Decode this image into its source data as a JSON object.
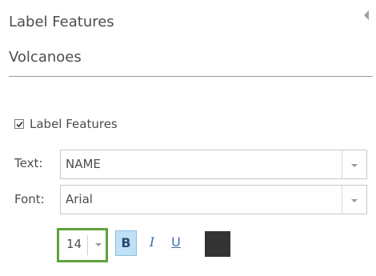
{
  "panel": {
    "title": "Label Features",
    "layer_name": "Volcanoes",
    "label_features_checkbox": {
      "label": "Label Features",
      "checked": true
    },
    "text_field": {
      "label": "Text:",
      "value": "NAME"
    },
    "font_field": {
      "label": "Font:",
      "value": "Arial"
    },
    "font_size": {
      "value": "14"
    },
    "format_buttons": {
      "bold": "B",
      "italic": "I",
      "underline": "U"
    },
    "bold_active": true,
    "text_color": "#333333",
    "highlight_color": "#5fa33b"
  }
}
